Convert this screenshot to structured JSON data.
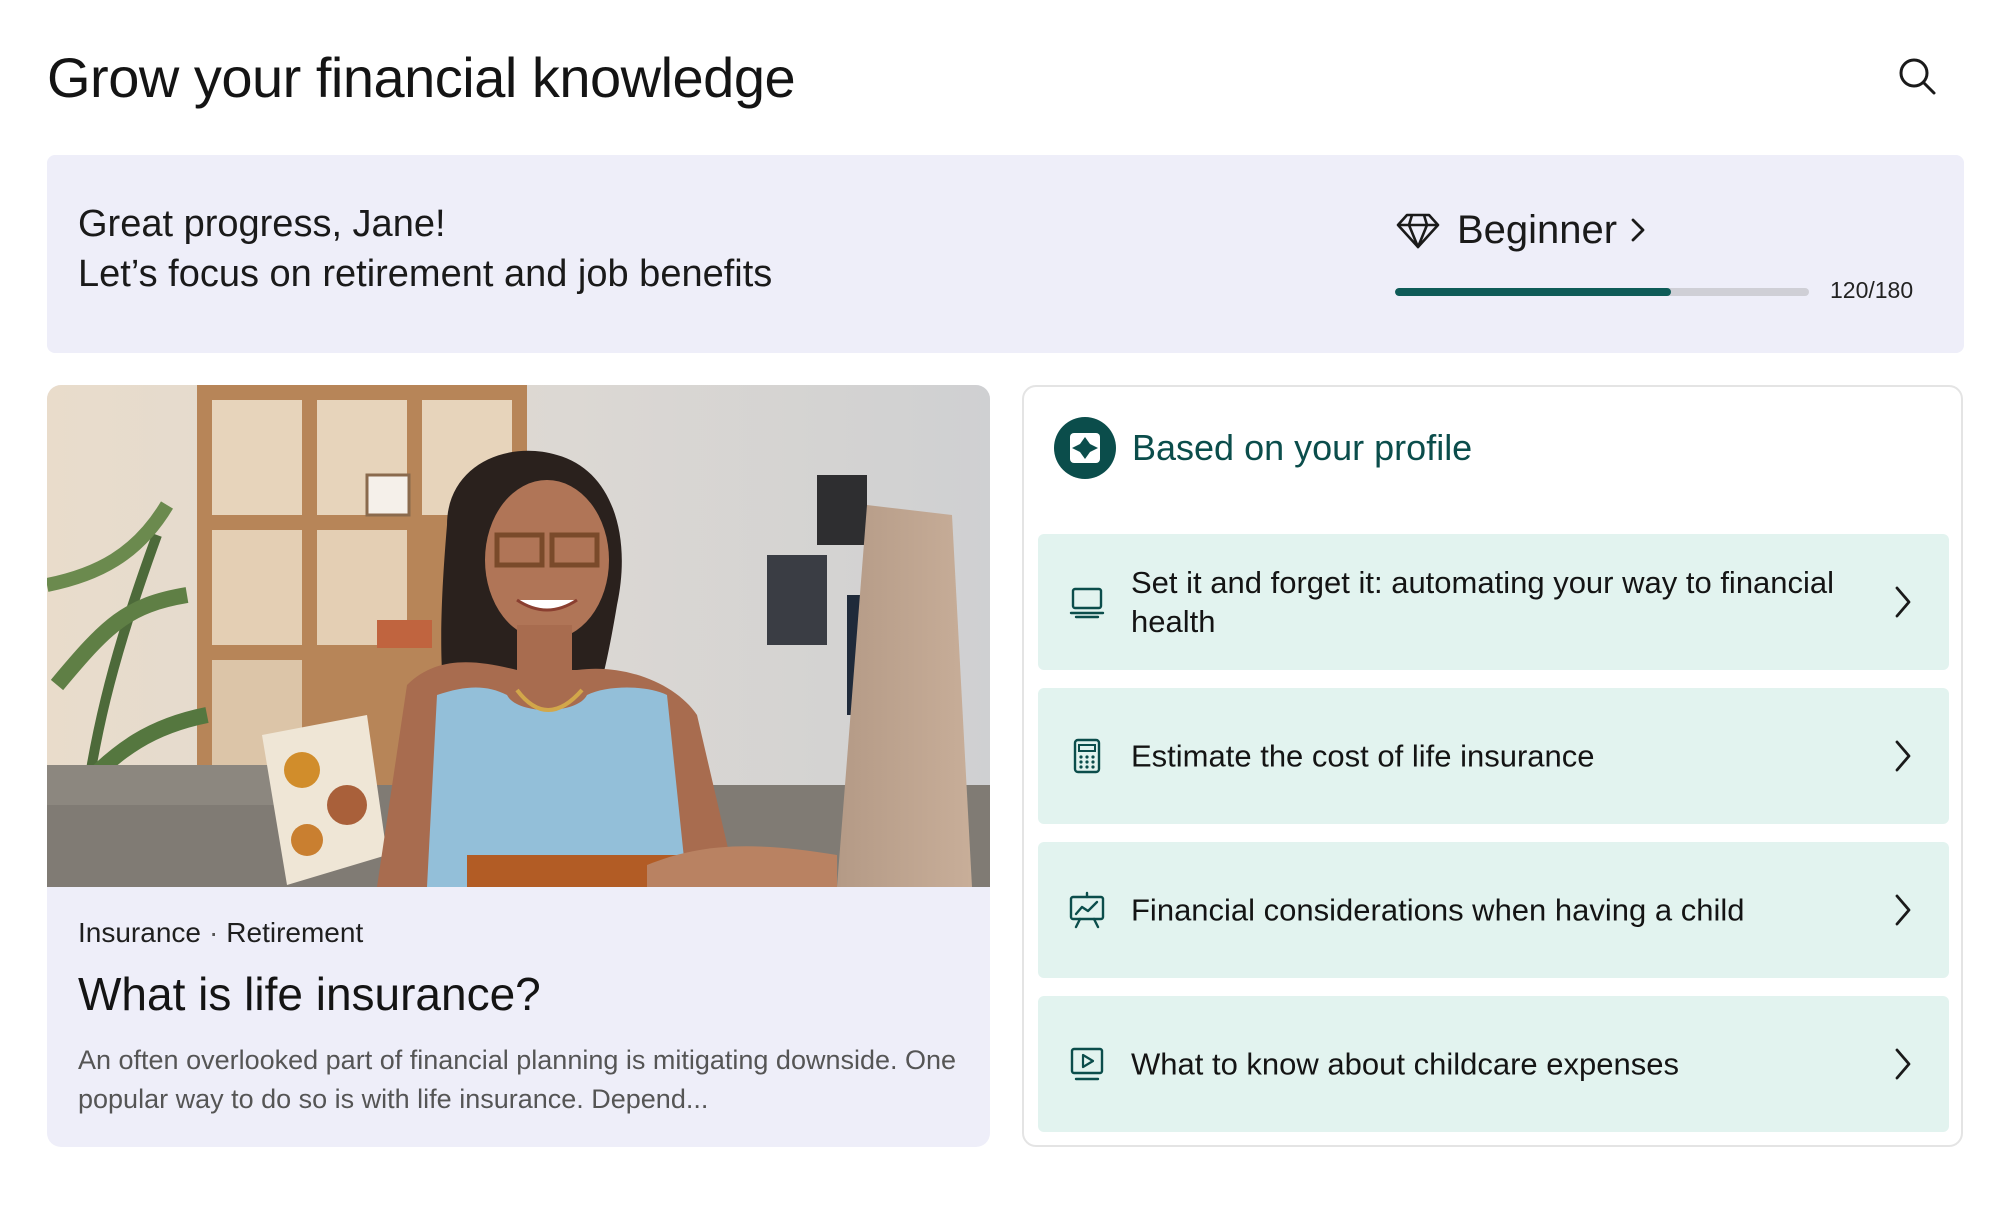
{
  "header": {
    "title": "Grow your financial knowledge",
    "search_icon": "search-icon"
  },
  "banner": {
    "greeting": "Great progress, Jane!",
    "focus": "Let’s focus on retirement and job benefits",
    "level_icon": "diamond-icon",
    "level": "Beginner",
    "progress_text": "120/180",
    "progress_current": 120,
    "progress_total": 180,
    "colors": {
      "background": "#eeeef9",
      "progress_fill": "#0e5b58",
      "progress_track": "#cfcfd6"
    }
  },
  "article": {
    "tag_1": "Insurance",
    "tag_separator": "·",
    "tag_2": "Retirement",
    "title": "What is life insurance?",
    "description": "An often overlooked part of financial planning is mitigating downside. One popular way to do so is with life insurance. Depend..."
  },
  "recommendations": {
    "title": "Based on your profile",
    "header_icon": "profile-badge-icon",
    "accent_color": "#0b4d4b",
    "item_background": "#e2f3ef",
    "items": [
      {
        "label": "Set it and forget it: automating your way to financial health",
        "icon": "laptop-icon"
      },
      {
        "label": "Estimate the cost of  life insurance",
        "icon": "calculator-icon"
      },
      {
        "label": "Financial considerations when having a child",
        "icon": "presentation-chart-icon"
      },
      {
        "label": "What to know about childcare expenses",
        "icon": "video-play-icon"
      }
    ]
  }
}
